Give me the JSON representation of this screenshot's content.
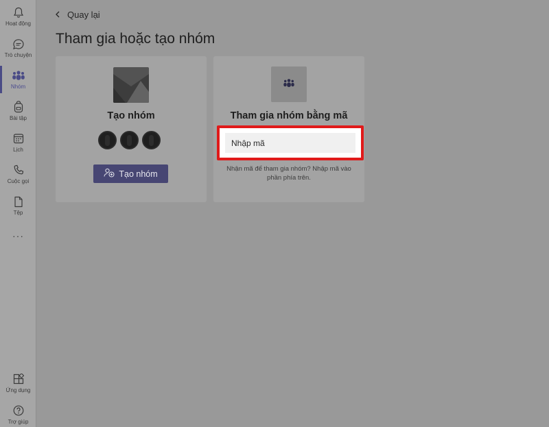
{
  "rail": {
    "items": [
      {
        "label": "Hoạt động",
        "icon": "bell-icon"
      },
      {
        "label": "Trò chuyện",
        "icon": "chat-icon"
      },
      {
        "label": "Nhóm",
        "icon": "teams-icon"
      },
      {
        "label": "Bài tập",
        "icon": "backpack-icon"
      },
      {
        "label": "Lịch",
        "icon": "calendar-icon"
      },
      {
        "label": "Cuộc gọi",
        "icon": "phone-icon"
      },
      {
        "label": "Tệp",
        "icon": "file-icon"
      }
    ],
    "more": "···",
    "bottom": [
      {
        "label": "Ứng dụng",
        "icon": "apps-icon"
      },
      {
        "label": "Trợ giúp",
        "icon": "help-icon"
      }
    ],
    "active_index": 2
  },
  "header": {
    "back_label": "Quay lại",
    "title": "Tham gia hoặc tạo nhóm"
  },
  "create_card": {
    "title": "Tạo nhóm",
    "button_label": "Tạo nhóm"
  },
  "join_card": {
    "title": "Tham gia nhóm bằng mã",
    "input_placeholder": "Nhập mã",
    "input_value": "",
    "hint": "Nhận mã để tham gia nhóm? Nhập mã vào phần phía trên."
  },
  "colors": {
    "accent": "#474673",
    "highlight_border": "#e01a1a"
  }
}
